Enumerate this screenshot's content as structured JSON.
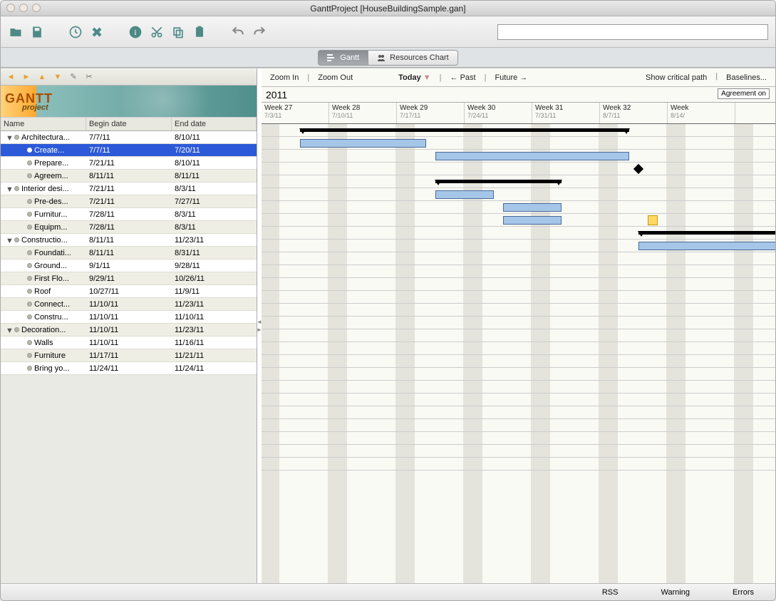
{
  "window": {
    "title": "GanttProject [HouseBuildingSample.gan]"
  },
  "tabs": {
    "gantt": "Gantt",
    "resources": "Resources Chart"
  },
  "columns": {
    "name": "Name",
    "begin": "Begin date",
    "end": "End date"
  },
  "gantt_toolbar": {
    "zoom_in": "Zoom In",
    "zoom_out": "Zoom Out",
    "today": "Today",
    "past": "Past",
    "future": "Future",
    "critical": "Show critical path",
    "baselines": "Baselines..."
  },
  "timeline": {
    "year": "2011",
    "marker": "Agreement on",
    "weeks": [
      {
        "label": "Week 27",
        "date": "7/3/11"
      },
      {
        "label": "Week 28",
        "date": "7/10/11"
      },
      {
        "label": "Week 29",
        "date": "7/17/11"
      },
      {
        "label": "Week 30",
        "date": "7/24/11"
      },
      {
        "label": "Week 31",
        "date": "7/31/11"
      },
      {
        "label": "Week 32",
        "date": "8/7/11"
      },
      {
        "label": "Week",
        "date": "8/14/"
      }
    ]
  },
  "tasks": [
    {
      "level": 0,
      "name": "Architectura...",
      "begin": "7/7/11",
      "end": "8/10/11",
      "expand": true,
      "type": "summary"
    },
    {
      "level": 1,
      "name": "Create...",
      "begin": "7/7/11",
      "end": "7/20/11",
      "selected": true,
      "type": "task"
    },
    {
      "level": 1,
      "name": "Prepare...",
      "begin": "7/21/11",
      "end": "8/10/11",
      "type": "task"
    },
    {
      "level": 1,
      "name": "Agreem...",
      "begin": "8/11/11",
      "end": "8/11/11",
      "type": "milestone"
    },
    {
      "level": 0,
      "name": "Interior desi...",
      "begin": "7/21/11",
      "end": "8/3/11",
      "expand": true,
      "type": "summary"
    },
    {
      "level": 1,
      "name": "Pre-des...",
      "begin": "7/21/11",
      "end": "7/27/11",
      "type": "task"
    },
    {
      "level": 1,
      "name": "Furnitur...",
      "begin": "7/28/11",
      "end": "8/3/11",
      "type": "task"
    },
    {
      "level": 1,
      "name": "Equipm...",
      "begin": "7/28/11",
      "end": "8/3/11",
      "type": "task",
      "note": true
    },
    {
      "level": 0,
      "name": "Constructio...",
      "begin": "8/11/11",
      "end": "11/23/11",
      "expand": true,
      "type": "summary"
    },
    {
      "level": 1,
      "name": "Foundati...",
      "begin": "8/11/11",
      "end": "8/31/11",
      "type": "task"
    },
    {
      "level": 1,
      "name": "Ground...",
      "begin": "9/1/11",
      "end": "9/28/11",
      "type": "task"
    },
    {
      "level": 1,
      "name": "First Flo...",
      "begin": "9/29/11",
      "end": "10/26/11",
      "type": "task"
    },
    {
      "level": 1,
      "name": "Roof",
      "begin": "10/27/11",
      "end": "11/9/11",
      "type": "task"
    },
    {
      "level": 1,
      "name": "Connect...",
      "begin": "11/10/11",
      "end": "11/23/11",
      "type": "task"
    },
    {
      "level": 1,
      "name": "Constru...",
      "begin": "11/10/11",
      "end": "11/10/11",
      "type": "milestone"
    },
    {
      "level": 0,
      "name": "Decoration...",
      "begin": "11/10/11",
      "end": "11/23/11",
      "expand": true,
      "type": "summary"
    },
    {
      "level": 1,
      "name": "Walls",
      "begin": "11/10/11",
      "end": "11/16/11",
      "type": "task"
    },
    {
      "level": 1,
      "name": "Furniture",
      "begin": "11/17/11",
      "end": "11/21/11",
      "type": "task"
    },
    {
      "level": 1,
      "name": "Bring yo...",
      "begin": "11/24/11",
      "end": "11/24/11",
      "type": "milestone"
    }
  ],
  "statusbar": {
    "rss": "RSS",
    "warning": "Warning",
    "errors": "Errors"
  },
  "logo": {
    "main": "GANTT",
    "sub": "project"
  }
}
